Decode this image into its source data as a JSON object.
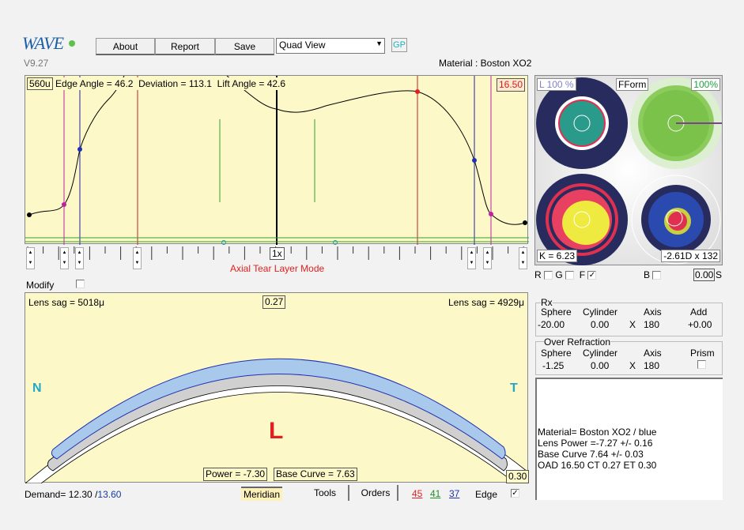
{
  "app": {
    "logo": "WAVE",
    "version": "V9.27",
    "status_color": "#5cc24a"
  },
  "toolbar": {
    "about": "About",
    "report": "Report",
    "save": "Save",
    "view_select": "Quad View",
    "gp": "GP"
  },
  "material_label": "Material : Boston XO2",
  "profile": {
    "scale": "560u",
    "edge_angle": "Edge Angle = 46.2",
    "deviation": "Deviation = 113.1",
    "lift_angle": "Lift Angle = 42.6",
    "diameter": "16.50",
    "zoom": "1x",
    "mode": "Axial Tear Layer Mode"
  },
  "modify_label": "Modify",
  "topo": {
    "left_pct": "L 100 %",
    "fform": "FForm",
    "right_pct": "100%",
    "k": "K = 6.23",
    "cyl": "-2.61D x 132"
  },
  "toggles": {
    "r": "R",
    "g": "G",
    "f": "F",
    "f_checked": true,
    "b": "B",
    "s_value": "0.00",
    "s": "S"
  },
  "lens": {
    "sag_left": "Lens sag = 5018μ",
    "sag_right": "Lens sag = 4929μ",
    "center_thickness": "0.27",
    "n": "N",
    "t": "T",
    "eye": "L",
    "power": "Power = -7.30",
    "base_curve": "Base Curve = 7.63",
    "edge_thickness": "0.30"
  },
  "rx": {
    "title": "Rx",
    "headers": [
      "Sphere",
      "Cylinder",
      "Axis",
      "Add"
    ],
    "sphere": "-20.00",
    "cylinder": "0.00",
    "x": "X",
    "axis": "180",
    "add": "+0.00"
  },
  "over_refraction": {
    "title": "Over Refraction",
    "headers": [
      "Sphere",
      "Cylinder",
      "Axis",
      "Prism"
    ],
    "sphere": "-1.25",
    "cylinder": "0.00",
    "x": "X",
    "axis": "180"
  },
  "summary": [
    "Material= Boston XO2 / blue",
    "Lens Power =-7.27 +/- 0.16",
    "Base Curve 7.64 +/- 0.03",
    "OAD 16.50 CT 0.27 ET 0.30"
  ],
  "bottom": {
    "demand_label": "Demand= 12.30 /",
    "demand_value": "13.60",
    "meridian": "Meridian",
    "tools": "Tools",
    "orders": "Orders",
    "n45": "45",
    "n41": "41",
    "n37": "37",
    "edge": "Edge",
    "edge_checked": true
  }
}
